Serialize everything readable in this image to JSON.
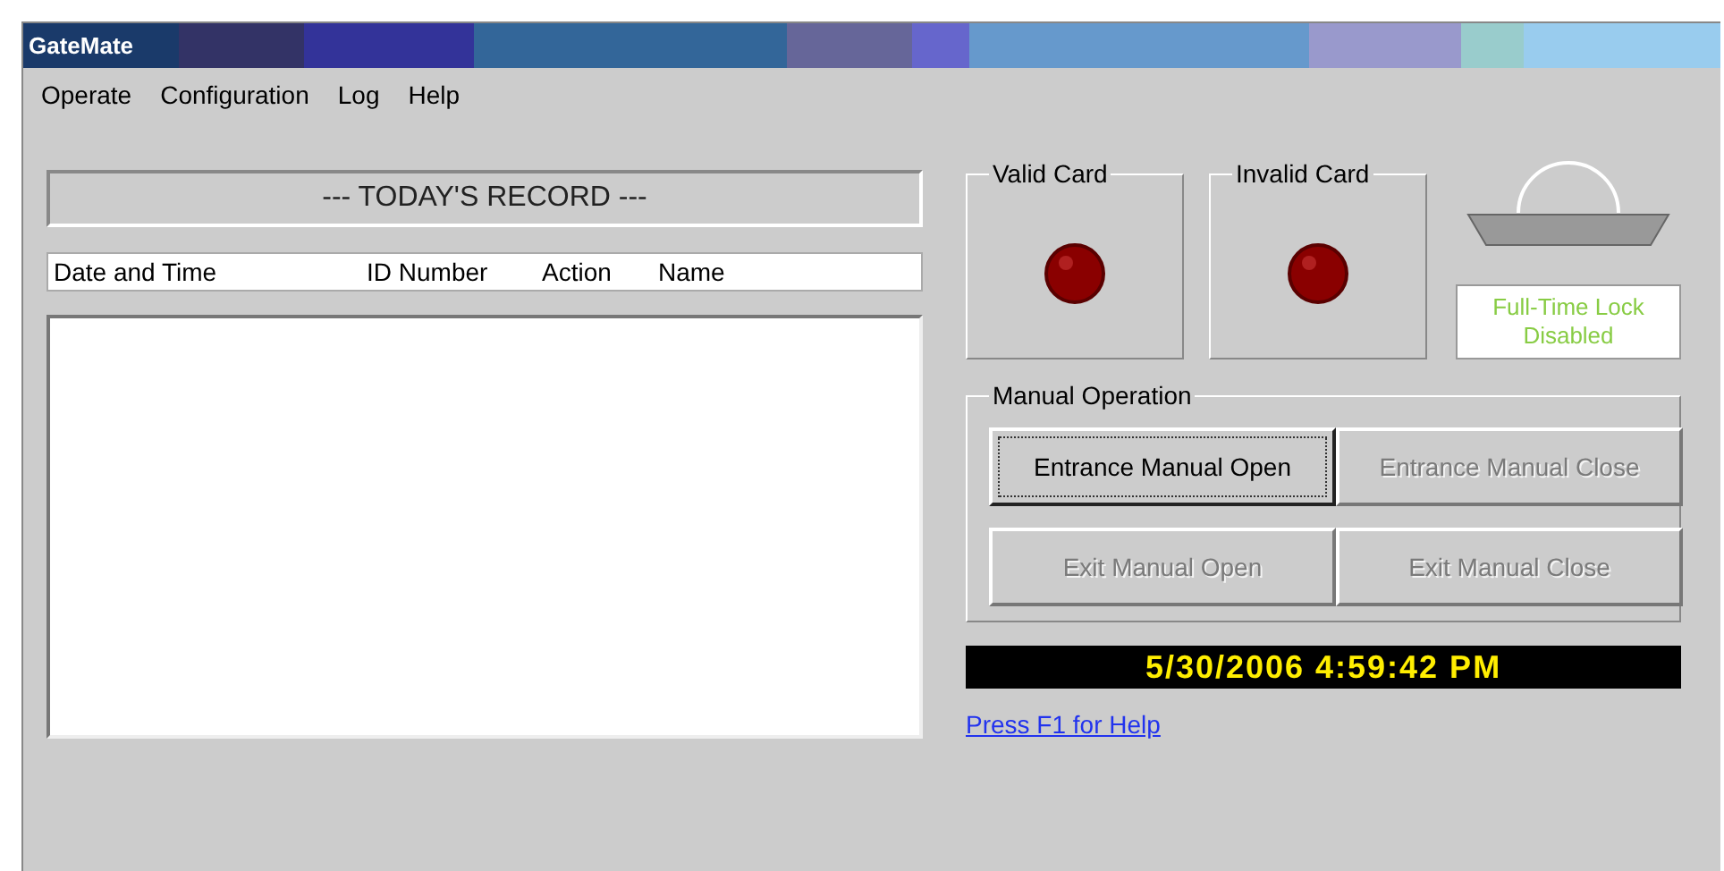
{
  "window": {
    "title": "GateMate"
  },
  "menu": [
    "Operate",
    "Configuration",
    "Log",
    "Help"
  ],
  "record": {
    "title": "--- TODAY'S RECORD ---",
    "columns": [
      "Date and Time",
      "ID Number",
      "Action",
      "Name"
    ]
  },
  "indicators": [
    {
      "label": "Valid Card",
      "lit": false
    },
    {
      "label": "Invalid Card",
      "lit": false
    }
  ],
  "lock": {
    "status": "Full-Time Lock\nDisabled"
  },
  "manual_operation": {
    "title": "Manual Operation",
    "buttons": [
      {
        "label": "Entrance Manual Open",
        "disabled": false,
        "focused": true
      },
      {
        "label": "Entrance Manual Close",
        "disabled": true,
        "focused": false
      },
      {
        "label": "Exit Manual Open",
        "disabled": true,
        "focused": false
      },
      {
        "label": "Exit Manual Close",
        "disabled": true,
        "focused": false
      }
    ]
  },
  "clock": "5/30/2006 4:59:42 PM",
  "help_link": "Press F1 for Help"
}
